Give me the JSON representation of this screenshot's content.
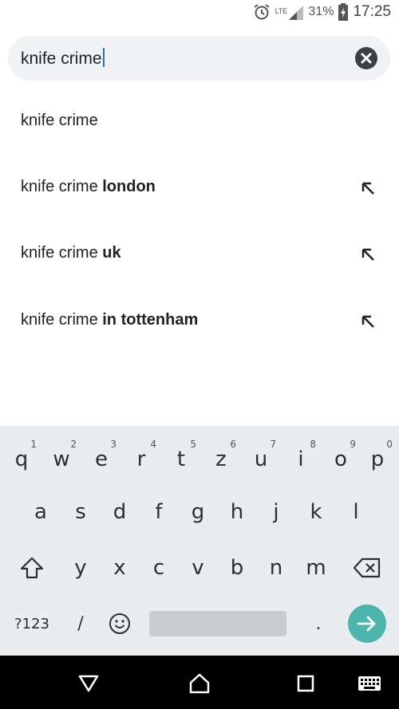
{
  "status_bar": {
    "network_label": "LTE",
    "battery_percent": "31%",
    "time": "17:25",
    "icons": [
      "alarm-icon",
      "signal-icon",
      "battery-charging-icon"
    ]
  },
  "search": {
    "query": "knife crime",
    "icons": [
      "clear-icon"
    ]
  },
  "suggestions": [
    {
      "prefix": "knife crime",
      "bold": "",
      "has_fill_arrow": false
    },
    {
      "prefix": "knife crime ",
      "bold": "london",
      "has_fill_arrow": true
    },
    {
      "prefix": "knife crime ",
      "bold": "uk",
      "has_fill_arrow": true
    },
    {
      "prefix": "knife crime ",
      "bold": "in tottenham",
      "has_fill_arrow": true
    }
  ],
  "keyboard": {
    "row1": [
      {
        "k": "q",
        "h": "1"
      },
      {
        "k": "w",
        "h": "2"
      },
      {
        "k": "e",
        "h": "3"
      },
      {
        "k": "r",
        "h": "4"
      },
      {
        "k": "t",
        "h": "5"
      },
      {
        "k": "z",
        "h": "6"
      },
      {
        "k": "u",
        "h": "7"
      },
      {
        "k": "i",
        "h": "8"
      },
      {
        "k": "o",
        "h": "9"
      },
      {
        "k": "p",
        "h": "0"
      }
    ],
    "row2": [
      "a",
      "s",
      "d",
      "f",
      "g",
      "h",
      "j",
      "k",
      "l"
    ],
    "row3": [
      "y",
      "x",
      "c",
      "v",
      "b",
      "n",
      "m"
    ],
    "symbols_label": "?123",
    "slash": "/",
    "period": ".",
    "icons": [
      "shift-icon",
      "backspace-icon",
      "emoji-icon",
      "enter-arrow-icon"
    ],
    "accent_color": "#4db6ac"
  },
  "nav_bar": {
    "icons": [
      "back-icon",
      "home-icon",
      "recents-icon",
      "keyboard-switch-icon"
    ]
  }
}
